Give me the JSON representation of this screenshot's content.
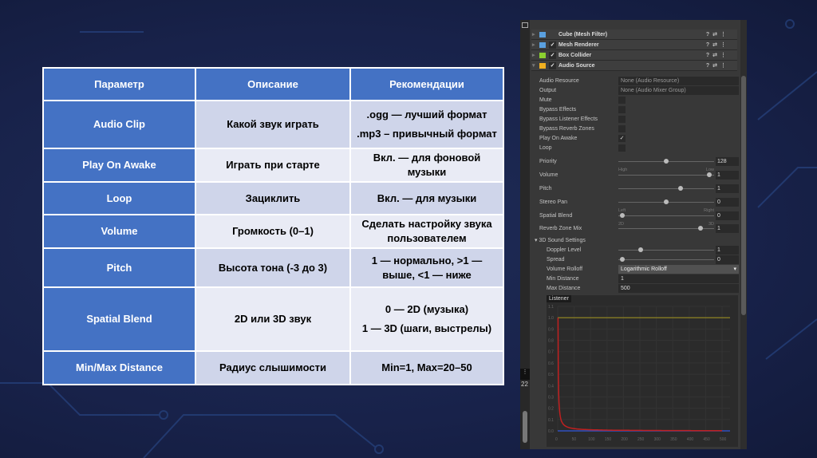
{
  "table": {
    "headers": [
      "Параметр",
      "Описание",
      "Рекомендации"
    ],
    "rows": [
      {
        "param": "Audio Clip",
        "desc": "Какой звук играть",
        "rec": [
          ".ogg — лучший формат",
          ".mp3 – привычный формат"
        ]
      },
      {
        "param": "Play On Awake",
        "desc": "Играть при старте",
        "rec": [
          "Вкл. — для фоновой музыки"
        ]
      },
      {
        "param": "Loop",
        "desc": "Зациклить",
        "rec": [
          "Вкл. — для музыки"
        ]
      },
      {
        "param": "Volume",
        "desc": "Громкость (0–1)",
        "rec": [
          "Сделать настройку звука пользователем"
        ]
      },
      {
        "param": "Pitch",
        "desc": "Высота тона (-3 до 3)",
        "rec": [
          "1 — нормально, >1 — выше, <1 — ниже"
        ]
      },
      {
        "param": "Spatial Blend",
        "desc": "2D или 3D звук",
        "rec": [
          "0 — 2D (музыка)",
          "1 — 3D (шаги, выстрелы)"
        ]
      },
      {
        "param": "Min/Max Distance",
        "desc": "Радиус слышимости",
        "rec": [
          "Min=1, Max=20–50"
        ]
      }
    ]
  },
  "inspector": {
    "components": [
      "Cube (Mesh Filter)",
      "Mesh Renderer",
      "Box Collider",
      "Audio Source"
    ],
    "audio_resource": {
      "label": "Audio Resource",
      "value": "None (Audio Resource)"
    },
    "output": {
      "label": "Output",
      "value": "None (Audio Mixer Group)"
    },
    "toggles": [
      {
        "label": "Mute",
        "on": false
      },
      {
        "label": "Bypass Effects",
        "on": false
      },
      {
        "label": "Bypass Listener Effects",
        "on": false
      },
      {
        "label": "Bypass Reverb Zones",
        "on": false
      },
      {
        "label": "Play On Awake",
        "on": true
      },
      {
        "label": "Loop",
        "on": false
      }
    ],
    "check_glyph": "✓",
    "sliders": [
      {
        "label": "Priority",
        "value": "128",
        "pos": 0.5,
        "min_label": "High",
        "max_label": "Low"
      },
      {
        "label": "Volume",
        "value": "1",
        "pos": 0.97
      },
      {
        "label": "Pitch",
        "value": "1",
        "pos": 0.66
      },
      {
        "label": "Stereo Pan",
        "value": "0",
        "pos": 0.5,
        "min_label": "Left",
        "max_label": "Right"
      },
      {
        "label": "Spatial Blend",
        "value": "0",
        "pos": 0.02,
        "min_label": "2D",
        "max_label": "3D"
      },
      {
        "label": "Reverb Zone Mix",
        "value": "1",
        "pos": 0.88
      }
    ],
    "sound3d": {
      "title": "3D Sound Settings",
      "doppler": {
        "label": "Doppler Level",
        "value": "1",
        "pos": 0.22
      },
      "spread": {
        "label": "Spread",
        "value": "0",
        "pos": 0.02
      },
      "rolloff": {
        "label": "Volume Rolloff",
        "value": "Logarithmic Rolloff"
      },
      "min": {
        "label": "Min Distance",
        "value": "1"
      },
      "max": {
        "label": "Max Distance",
        "value": "500"
      }
    },
    "graph": {
      "tab": "Listener",
      "yticks": [
        "1.1",
        "1.0",
        "0.9",
        "0.8",
        "0.7",
        "0.6",
        "0.5",
        "0.4",
        "0.3",
        "0.2",
        "0.1",
        "0.0"
      ],
      "xticks": [
        "0",
        "50",
        "100",
        "150",
        "200",
        "250",
        "300",
        "350",
        "400",
        "450",
        "500"
      ]
    },
    "side_number": "22"
  }
}
